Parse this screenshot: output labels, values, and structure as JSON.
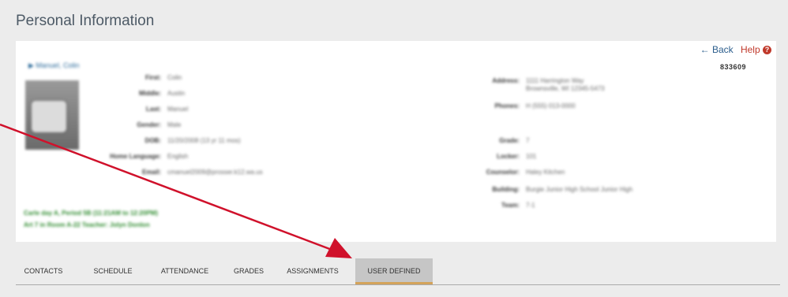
{
  "page": {
    "title": "Personal Information"
  },
  "header": {
    "back_label": "Back",
    "help_label": "Help",
    "student_id": "833609"
  },
  "student": {
    "name": "Manuel, Colin"
  },
  "left_fields": [
    {
      "label": "First:",
      "value": "Colin"
    },
    {
      "label": "Middle:",
      "value": "Austin"
    },
    {
      "label": "Last:",
      "value": "Manuel"
    },
    {
      "label": "Gender:",
      "value": "Male"
    },
    {
      "label": "DOB:",
      "value": "11/20/2008 (13 yr 11 mos)"
    },
    {
      "label": "Home Language:",
      "value": "English"
    },
    {
      "label": "Email:",
      "value": "cmanuel2009@prosser.k12.wa.us"
    }
  ],
  "right_fields": [
    {
      "label": "Address:",
      "value": "1111 Harrington Way",
      "value2": "Brownsville, WI 12345-5473"
    },
    {
      "label": "Phones:",
      "value": "H (555) 013-0000"
    },
    {
      "label": "Grade:",
      "value": "7"
    },
    {
      "label": "Locker:",
      "value": "101"
    },
    {
      "label": "Counselor:",
      "value": "Haley Kitchen"
    },
    {
      "label": "Building:",
      "value": "Burgie Junior High School Junior High"
    },
    {
      "label": "Team:",
      "value": "7-1"
    }
  ],
  "schedule_note": {
    "line1": "Carle day A, Period 5B (11:21AM to 12:20PM)",
    "line2": "Art 7 in Room A-22 Teacher: Jolyn Donlon"
  },
  "tabs": [
    "CONTACTS",
    "SCHEDULE",
    "ATTENDANCE",
    "GRADES",
    "ASSIGNMENTS",
    "USER DEFINED"
  ],
  "active_tab": "USER DEFINED",
  "colors": {
    "accent": "#d4a35a",
    "arrow": "#d0112b",
    "link": "#2b5d8c",
    "help": "#c0392b",
    "green_text": "#2e8b2e"
  }
}
